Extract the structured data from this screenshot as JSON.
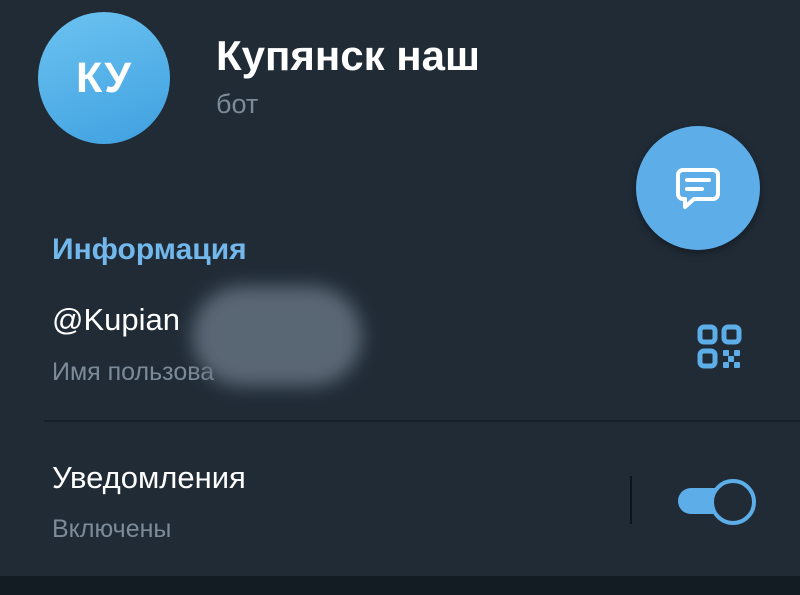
{
  "profile": {
    "avatar_initials": "КУ",
    "name": "Купянск наш",
    "type": "бот"
  },
  "fab": {
    "icon": "message-icon"
  },
  "info": {
    "section_title": "Информация",
    "username": "@Kupian",
    "username_caption": "Имя пользова",
    "qr_icon": "qr-code-icon",
    "notifications_label": "Уведомления",
    "notifications_status": "Включены",
    "notifications_enabled": true
  },
  "colors": {
    "accent": "#5cade8",
    "section_title": "#72b8ec",
    "panel": "#202b36",
    "background": "#18222d"
  }
}
